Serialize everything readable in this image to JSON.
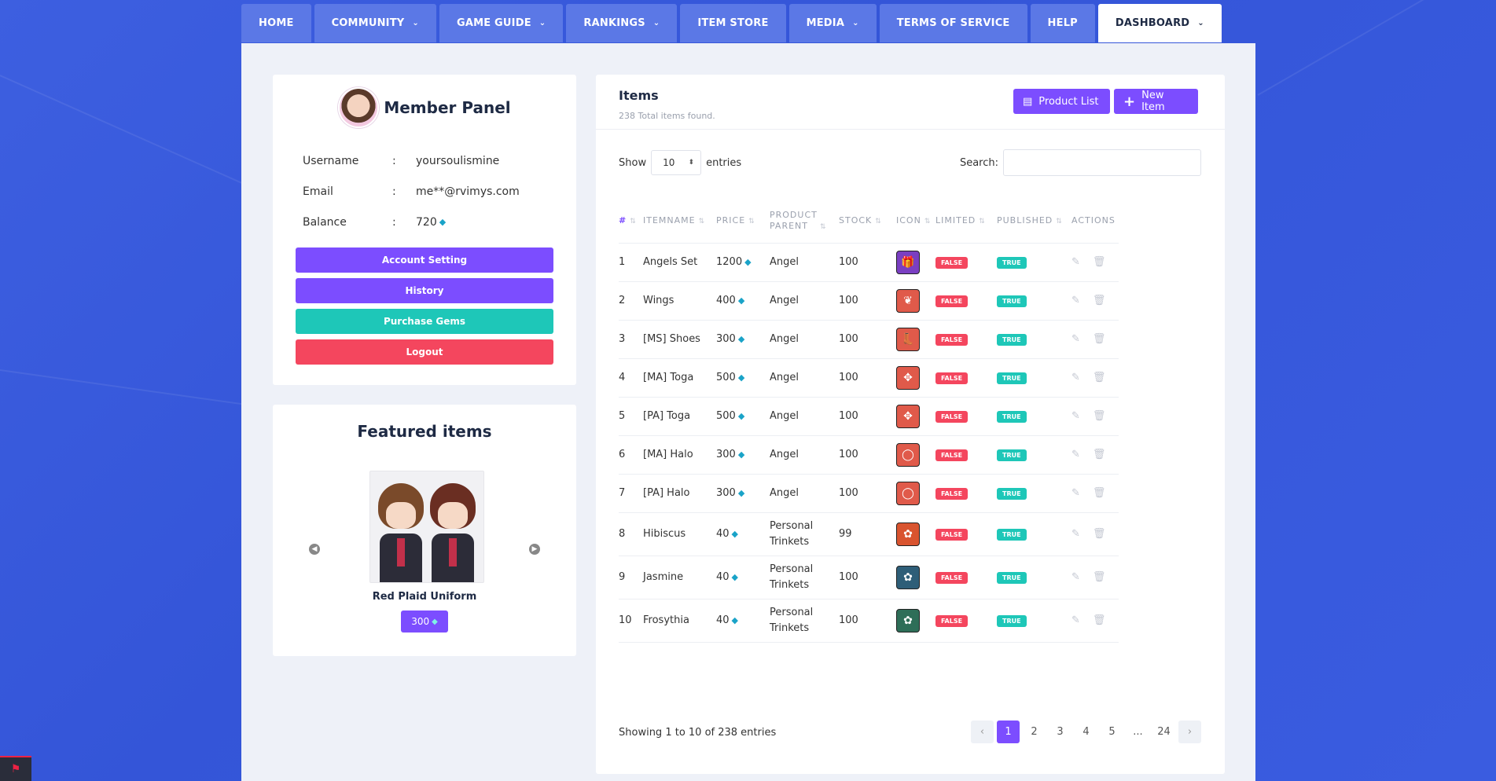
{
  "nav": [
    {
      "label": "HOME",
      "dropdown": false,
      "active": false
    },
    {
      "label": "COMMUNITY",
      "dropdown": true,
      "active": false
    },
    {
      "label": "GAME GUIDE",
      "dropdown": true,
      "active": false
    },
    {
      "label": "RANKINGS",
      "dropdown": true,
      "active": false
    },
    {
      "label": "ITEM STORE",
      "dropdown": false,
      "active": false
    },
    {
      "label": "MEDIA",
      "dropdown": true,
      "active": false
    },
    {
      "label": "TERMS OF SERVICE",
      "dropdown": false,
      "active": false
    },
    {
      "label": "HELP",
      "dropdown": false,
      "active": false
    },
    {
      "label": "DASHBOARD",
      "dropdown": true,
      "active": true
    }
  ],
  "member": {
    "title": "Member Panel",
    "rows": [
      {
        "key": "Username",
        "sep": ":",
        "value": "yoursoulismine"
      },
      {
        "key": "Email",
        "sep": ":",
        "value": "me**@rvimys.com"
      },
      {
        "key": "Balance",
        "sep": ":",
        "value": "720"
      }
    ],
    "buttons": {
      "account": "Account Setting",
      "history": "History",
      "gems": "Purchase Gems",
      "logout": "Logout"
    }
  },
  "featured": {
    "title": "Featured items",
    "name": "Red Plaid Uniform",
    "price": "300"
  },
  "items": {
    "title": "Items",
    "subtitle": "238 Total items found.",
    "product_list": "Product List",
    "new_item": "New Item",
    "show": "Show",
    "entries": "entries",
    "per_page": "10",
    "search_label": "Search:",
    "columns": [
      "#",
      "ITEMNAME",
      "PRICE",
      "PRODUCT PARENT",
      "STOCK",
      "ICON",
      "LIMITED",
      "PUBLISHED",
      "ACTIONS"
    ],
    "rows": [
      {
        "id": "1",
        "name": "Angels Set",
        "price": "1200",
        "parent": "Angel",
        "stock": "100",
        "icon": "gift-box-icon",
        "icon_bg": "#7a3fc2",
        "limited": "FALSE",
        "published": "TRUE"
      },
      {
        "id": "2",
        "name": "Wings",
        "price": "400",
        "parent": "Angel",
        "stock": "100",
        "icon": "wings-icon",
        "icon_bg": "#e05a4a",
        "limited": "FALSE",
        "published": "TRUE"
      },
      {
        "id": "3",
        "name": "[MS] Shoes",
        "price": "300",
        "parent": "Angel",
        "stock": "100",
        "icon": "shoes-icon",
        "icon_bg": "#e05a4a",
        "limited": "FALSE",
        "published": "TRUE"
      },
      {
        "id": "4",
        "name": "[MA] Toga",
        "price": "500",
        "parent": "Angel",
        "stock": "100",
        "icon": "toga-icon",
        "icon_bg": "#e05a4a",
        "limited": "FALSE",
        "published": "TRUE"
      },
      {
        "id": "5",
        "name": "[PA] Toga",
        "price": "500",
        "parent": "Angel",
        "stock": "100",
        "icon": "toga-icon",
        "icon_bg": "#e05a4a",
        "limited": "FALSE",
        "published": "TRUE"
      },
      {
        "id": "6",
        "name": "[MA] Halo",
        "price": "300",
        "parent": "Angel",
        "stock": "100",
        "icon": "halo-icon",
        "icon_bg": "#e05a4a",
        "limited": "FALSE",
        "published": "TRUE"
      },
      {
        "id": "7",
        "name": "[PA] Halo",
        "price": "300",
        "parent": "Angel",
        "stock": "100",
        "icon": "halo-icon",
        "icon_bg": "#e05a4a",
        "limited": "FALSE",
        "published": "TRUE"
      },
      {
        "id": "8",
        "name": "Hibiscus",
        "price": "40",
        "parent": "Personal Trinkets",
        "stock": "99",
        "icon": "flower-icon",
        "icon_bg": "#d9542f",
        "limited": "FALSE",
        "published": "TRUE"
      },
      {
        "id": "9",
        "name": "Jasmine",
        "price": "40",
        "parent": "Personal Trinkets",
        "stock": "100",
        "icon": "flower-icon",
        "icon_bg": "#2e5e78",
        "limited": "FALSE",
        "published": "TRUE"
      },
      {
        "id": "10",
        "name": "Frosythia",
        "price": "40",
        "parent": "Personal Trinkets",
        "stock": "100",
        "icon": "flower-icon",
        "icon_bg": "#2e6e58",
        "limited": "FALSE",
        "published": "TRUE"
      }
    ],
    "showing": "Showing 1 to 10 of 238 entries",
    "pages": [
      "1",
      "2",
      "3",
      "4",
      "5",
      "...",
      "24"
    ],
    "current_page": "1"
  },
  "colors": {
    "accent": "#7c4dff",
    "teal": "#1ec7b8",
    "danger": "#f4465e",
    "background": "#3455d8"
  }
}
